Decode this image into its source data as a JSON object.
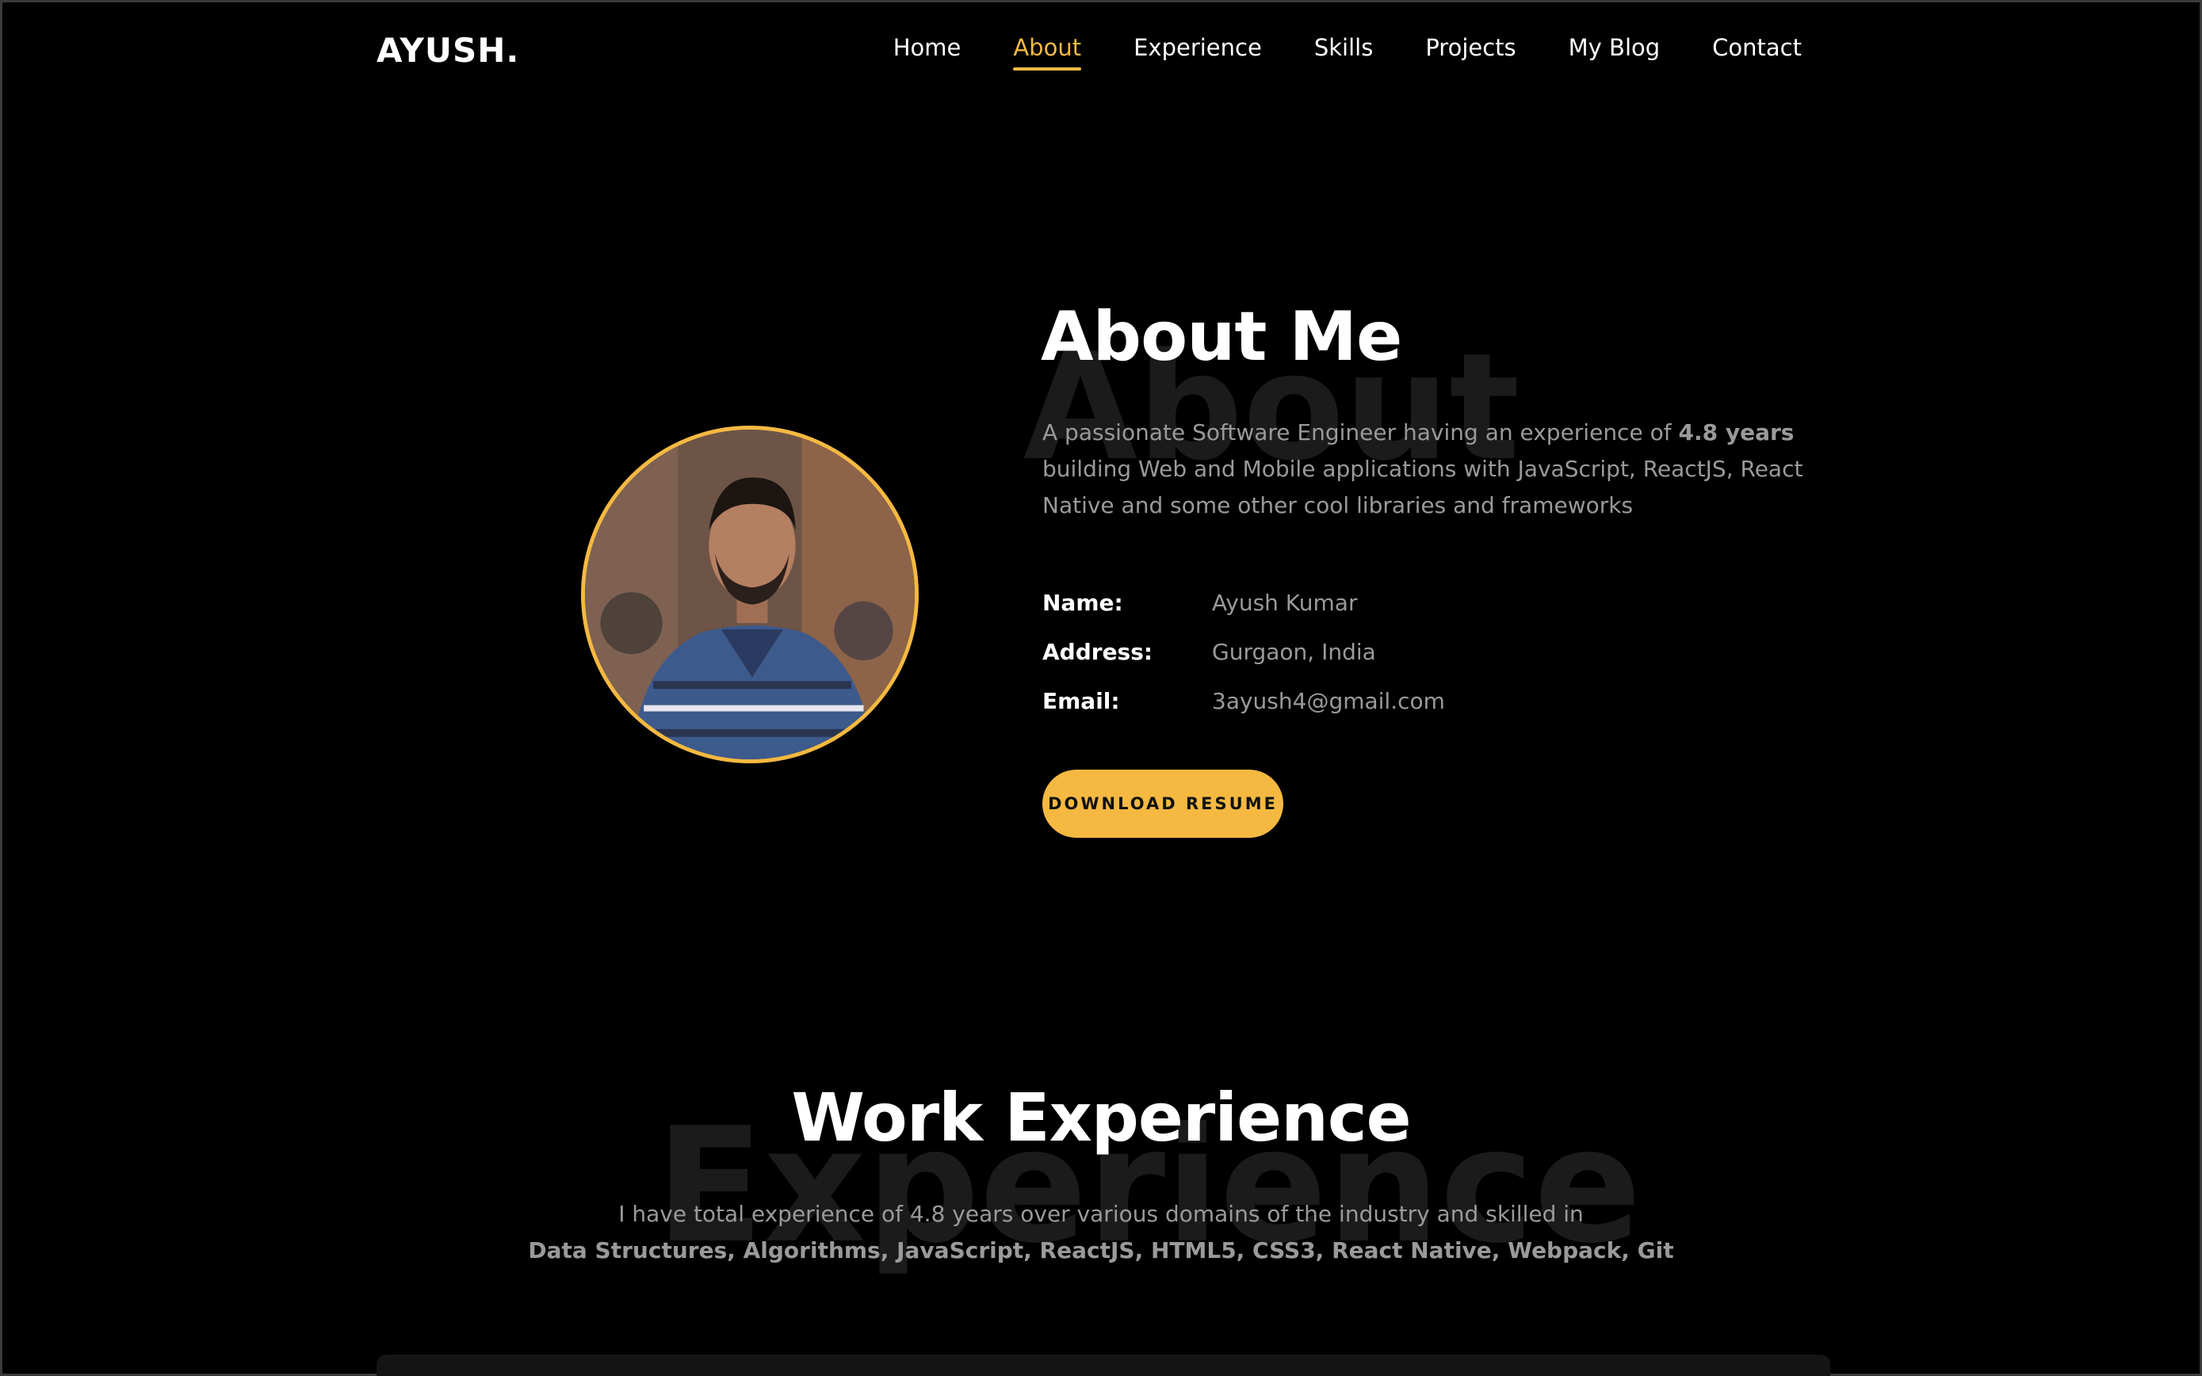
{
  "header": {
    "logo": "AYUSH.",
    "nav": [
      {
        "label": "Home",
        "active": false
      },
      {
        "label": "About",
        "active": true
      },
      {
        "label": "Experience",
        "active": false
      },
      {
        "label": "Skills",
        "active": false
      },
      {
        "label": "Projects",
        "active": false
      },
      {
        "label": "My Blog",
        "active": false
      },
      {
        "label": "Contact",
        "active": false
      }
    ]
  },
  "about": {
    "bg_word": "About",
    "title": "About Me",
    "desc_before": "A passionate Software Engineer having an experience of ",
    "desc_bold": "4.8 years",
    "desc_after": " building Web and Mobile applications with JavaScript, ReactJS, React Native and some other cool libraries and frameworks",
    "info": [
      {
        "label": "Name:",
        "value": "Ayush Kumar"
      },
      {
        "label": "Address:",
        "value": "Gurgaon, India"
      },
      {
        "label": "Email:",
        "value": "3ayush4@gmail.com"
      }
    ],
    "resume_button": "DOWNLOAD RESUME"
  },
  "experience": {
    "bg_word": "Experience",
    "title": "Work Experience",
    "desc": "I have total experience of 4.8 years over various domains of the industry and skilled in",
    "skills": "Data Structures, Algorithms, JavaScript, ReactJS, HTML5, CSS3, React Native, Webpack, Git"
  },
  "colors": {
    "accent": "#f5b942",
    "background": "#000000",
    "muted_text": "#9a9a9a"
  }
}
